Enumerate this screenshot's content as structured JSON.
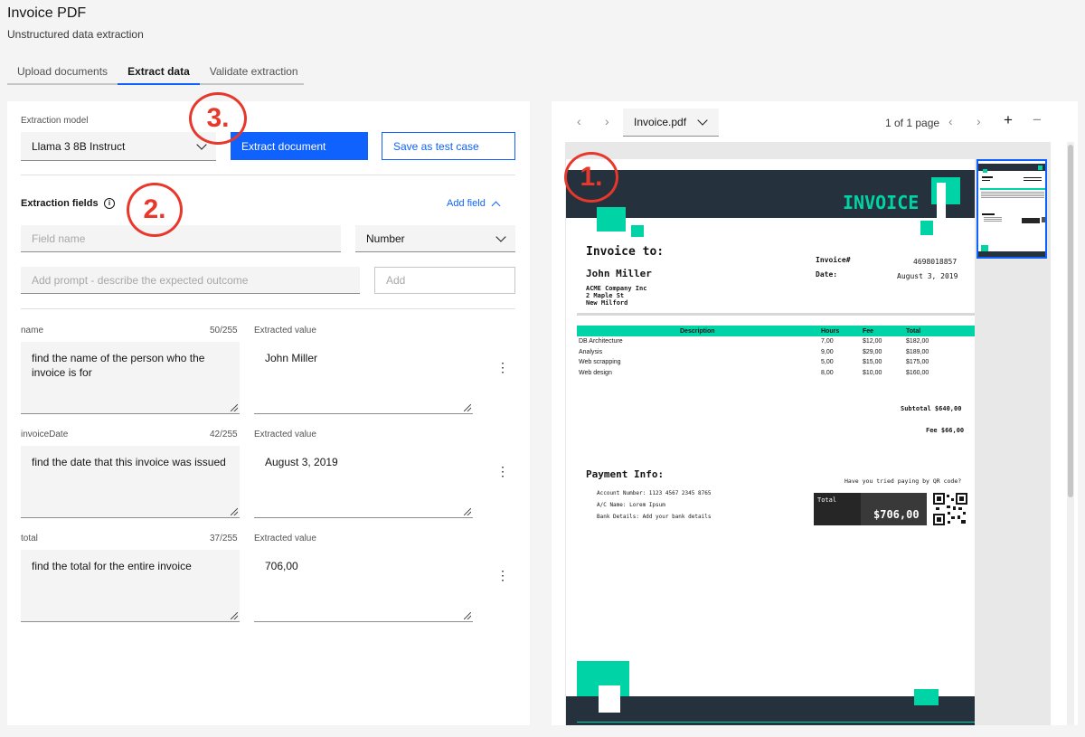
{
  "header": {
    "title": "Invoice PDF",
    "subtitle": "Unstructured data extraction",
    "tabs": [
      {
        "label": "Upload documents"
      },
      {
        "label": "Extract data"
      },
      {
        "label": "Validate extraction"
      }
    ]
  },
  "extraction": {
    "model_label": "Extraction model",
    "model_value": "Llama 3 8B Instruct",
    "extract_button": "Extract document",
    "save_button": "Save as test case",
    "fields_title": "Extraction fields",
    "add_field_link": "Add field",
    "field_name_placeholder": "Field name",
    "type_value": "Number",
    "prompt_placeholder": "Add prompt - describe the expected outcome",
    "add_placeholder": "Add",
    "extracted_label": "Extracted value",
    "fields": [
      {
        "name": "name",
        "count": "50/255",
        "prompt": "find the name of the person who the invoice is for",
        "value": "John Miller"
      },
      {
        "name": "invoiceDate",
        "count": "42/255",
        "prompt": "find the date that this invoice was issued",
        "value": "August 3, 2019"
      },
      {
        "name": "total",
        "count": "37/255",
        "prompt": "find the total for the entire invoice",
        "value": "706,00"
      }
    ]
  },
  "annotations": {
    "one": "1.",
    "two": "2.",
    "three": "3."
  },
  "viewer": {
    "file_name": "Invoice.pdf",
    "page_indicator": "1 of 1 page"
  },
  "invoice": {
    "heading": "INVOICE",
    "to_label": "Invoice to:",
    "customer_name": "John Miller",
    "company": "ACME Company Inc",
    "street": "2 Maple St",
    "city": "New Milford",
    "invoice_no_label": "Invoice#",
    "invoice_no": "4698018857",
    "date_label": "Date:",
    "date": "August 3, 2019",
    "columns": [
      "Description",
      "Hours",
      "Fee",
      "Total"
    ],
    "rows": [
      {
        "desc": "DB Architecture",
        "hours": "7,00",
        "fee": "$12,00",
        "total": "$182,00"
      },
      {
        "desc": "Analysis",
        "hours": "9,00",
        "fee": "$29,00",
        "total": "$189,00"
      },
      {
        "desc": "Web scrapping",
        "hours": "5,00",
        "fee": "$15,00",
        "total": "$175,00"
      },
      {
        "desc": "Web design",
        "hours": "8,00",
        "fee": "$10,00",
        "total": "$160,00"
      }
    ],
    "subtotal": "Subtotal $640,00",
    "fee": "Fee $66,00",
    "payment_title": "Payment Info:",
    "account": "Account Number: 1123 4567 2345 8765",
    "ac_name": "A/C Name: Lorem Ipsum",
    "bank": "Bank Details: Add your bank details",
    "qr_prompt": "Have you tried paying by QR code?",
    "total_label": "Total",
    "total_value": "$706,00"
  },
  "colors": {
    "primary": "#0f62fe",
    "invoice_dark": "#25313c",
    "invoice_green": "#00d4a6",
    "annotation": "#e8372b"
  }
}
